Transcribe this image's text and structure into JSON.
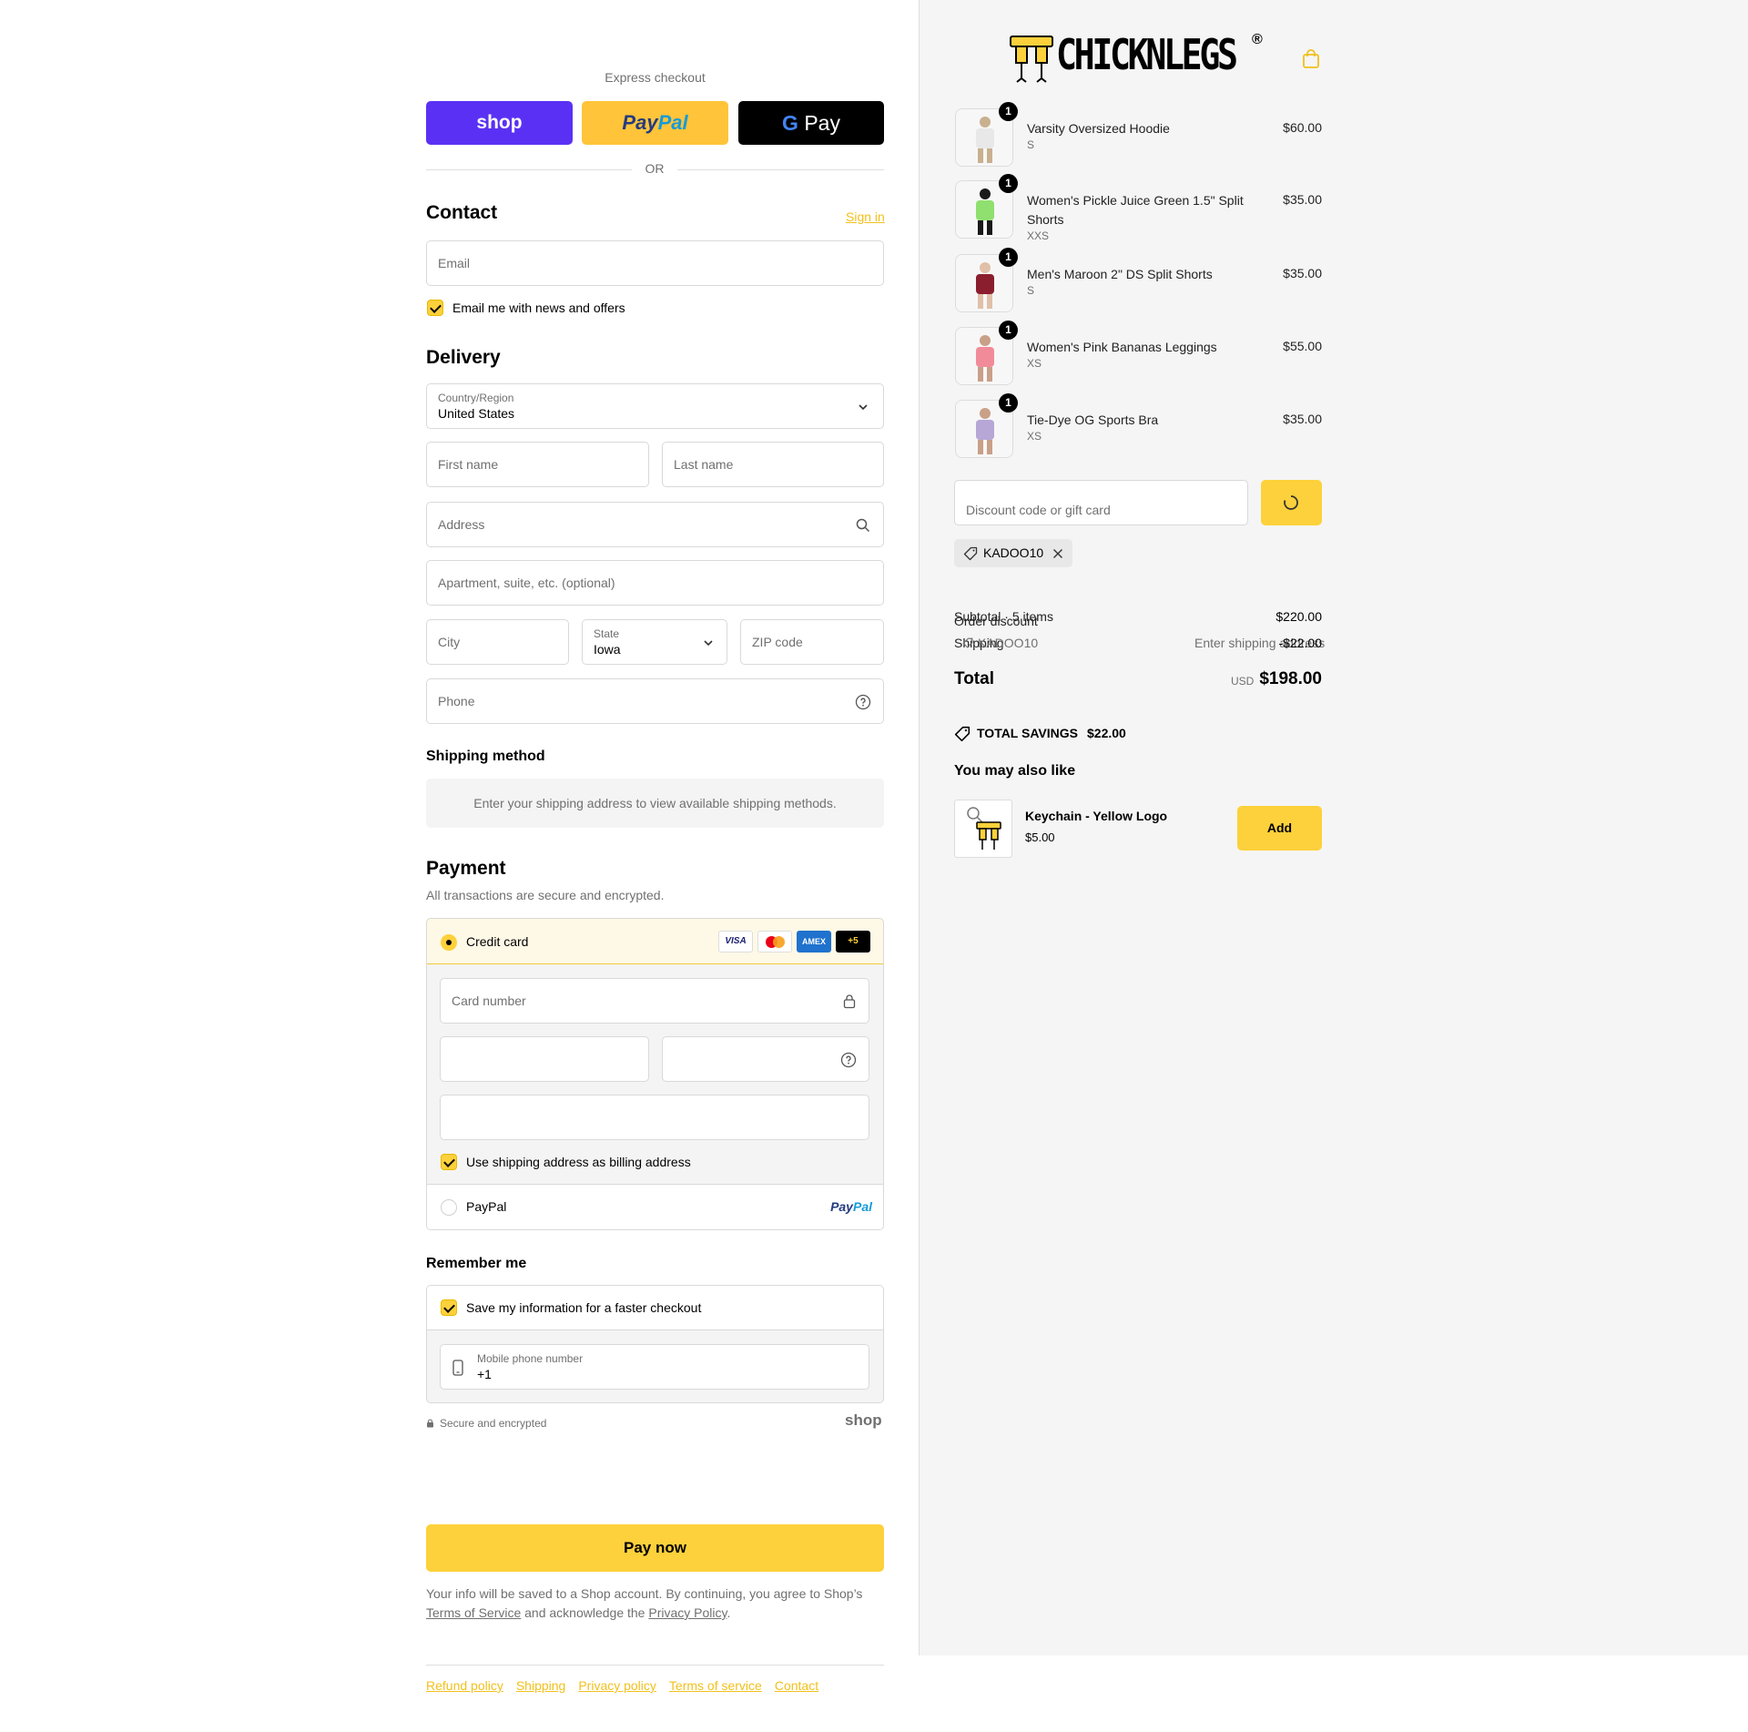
{
  "express": {
    "title": "Express checkout",
    "shop_label": "shop",
    "paypal_label_a": "Pay",
    "paypal_label_b": "Pal",
    "gpay_label": "Pay",
    "or_label": "OR"
  },
  "contact": {
    "heading": "Contact",
    "sign_in": "Sign in",
    "email_placeholder": "Email",
    "news_label": "Email me with news and offers"
  },
  "delivery": {
    "heading": "Delivery",
    "country_label": "Country/Region",
    "country_value": "United States",
    "first_name_placeholder": "First name",
    "last_name_placeholder": "Last name",
    "address_placeholder": "Address",
    "apartment_placeholder": "Apartment, suite, etc. (optional)",
    "city_placeholder": "City",
    "state_label": "State",
    "state_value": "Iowa",
    "zip_placeholder": "ZIP code",
    "phone_placeholder": "Phone"
  },
  "shipping_method": {
    "heading": "Shipping method",
    "message": "Enter your shipping address to view available shipping methods."
  },
  "payment": {
    "heading": "Payment",
    "subtitle": "All transactions are secure and encrypted.",
    "credit_card_label": "Credit card",
    "card_logos": [
      "VISA",
      "",
      "AMEX",
      "+5"
    ],
    "card_number_placeholder": "Card number",
    "billing_label": "Use shipping address as billing address",
    "paypal_label": "PayPal",
    "paypal_logo_a": "Pay",
    "paypal_logo_b": "Pal"
  },
  "remember": {
    "heading": "Remember me",
    "save_label": "Save my information for a faster checkout",
    "mobile_label": "Mobile phone number",
    "mobile_value": "+1",
    "secure_label": "Secure and encrypted",
    "shop_label": "shop"
  },
  "pay_now": "Pay now",
  "legal": {
    "text_a": "Your info will be saved to a Shop account. By continuing, you agree to Shop’s",
    "terms": "Terms of Service",
    "text_b": "and acknowledge the",
    "privacy": "Privacy Policy",
    "text_c": "."
  },
  "footer_links": [
    "Refund policy",
    "Shipping",
    "Privacy policy",
    "Terms of service",
    "Contact"
  ],
  "brand": {
    "name": "CHICKNLEGS",
    "reg": "®",
    "accent": "#fdd13b"
  },
  "cart": {
    "items": [
      {
        "name": "Varsity Oversized Hoodie",
        "variant": "S",
        "price": "$60.00",
        "qty": "1"
      },
      {
        "name": "Women's Pickle Juice Green 1.5\" Split Shorts",
        "variant": "XXS",
        "price": "$35.00",
        "qty": "1"
      },
      {
        "name": "Men's Maroon 2\" DS Split Shorts",
        "variant": "S",
        "price": "$35.00",
        "qty": "1"
      },
      {
        "name": "Women's Pink Bananas Leggings",
        "variant": "XS",
        "price": "$55.00",
        "qty": "1"
      },
      {
        "name": "Tie-Dye OG Sports Bra",
        "variant": "XS",
        "price": "$35.00",
        "qty": "1"
      }
    ],
    "discount_placeholder": "Discount code or gift card",
    "applied_code": "KADOO10"
  },
  "summary": {
    "subtotal_label": "Subtotal · 5 items",
    "subtotal_value": "$220.00",
    "order_discount_label": "Order discount",
    "discount_code_label": "KADOO10",
    "discount_value": "-$22.00",
    "shipping_label": "Shipping",
    "shipping_value": "Enter shipping address",
    "total_label": "Total",
    "currency": "USD",
    "total_value": "$198.00",
    "savings_label": "TOTAL SAVINGS",
    "savings_value": "$22.00"
  },
  "upsell": {
    "heading": "You may also like",
    "name": "Keychain - Yellow Logo",
    "price": "$5.00",
    "add_label": "Add"
  }
}
